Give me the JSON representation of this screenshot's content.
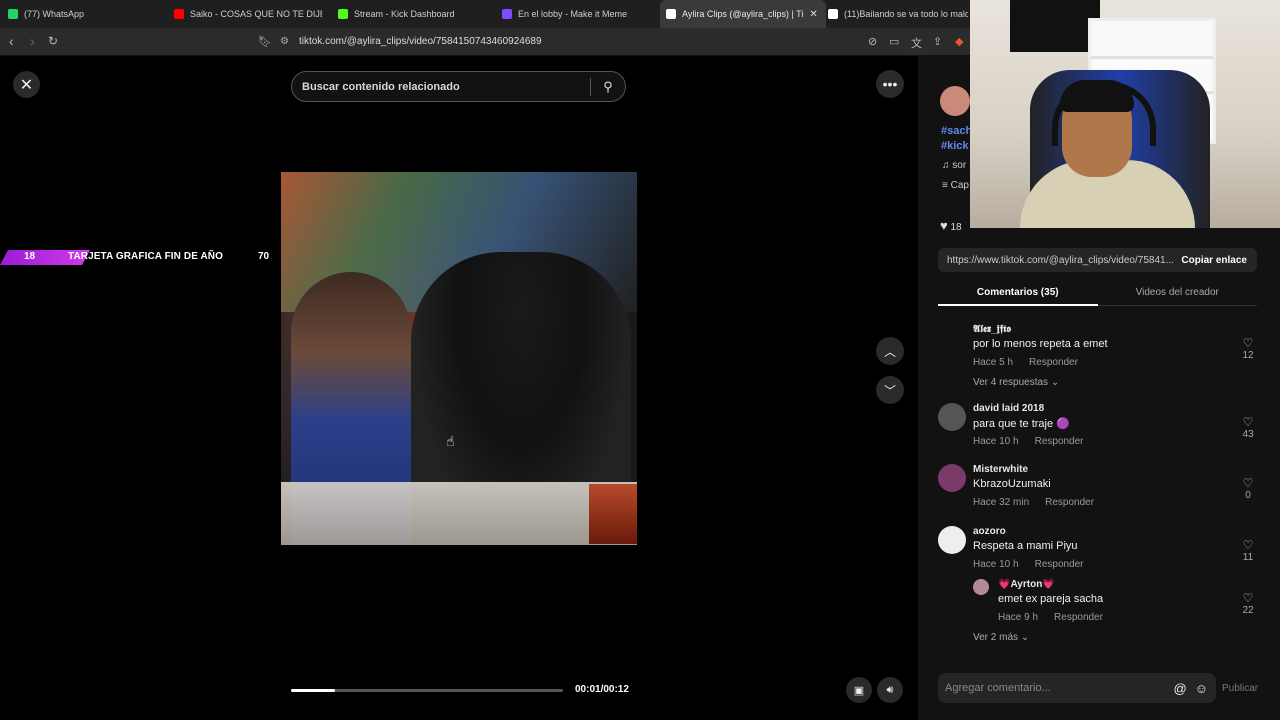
{
  "browser": {
    "tabs": [
      {
        "title": "(77) WhatsApp",
        "color": "#25d366"
      },
      {
        "title": "Saiko - COSAS QUE NO TE DIJE (Offi",
        "color": "#ff0000"
      },
      {
        "title": "Stream - Kick Dashboard",
        "color": "#53fc18"
      },
      {
        "title": "En el lobby - Make it Meme",
        "color": "#7e4bff"
      },
      {
        "title": "Aylira Clips (@aylira_clips) | Ti",
        "color": "#ffffff"
      },
      {
        "title": "(11)Bailando se va todo lo malo",
        "color": "#ffffff"
      }
    ],
    "url": "tiktok.com/@aylira_clips/video/7584150743460924689"
  },
  "overlay_banner": {
    "left_number": "18",
    "label": "TARJETA GRAFICA FIN DE AÑO",
    "right_number": "70"
  },
  "search": {
    "placeholder": "Buscar contenido relacionado"
  },
  "player": {
    "time": "00:01/00:12",
    "progress_fraction": 0.16
  },
  "side": {
    "hashtag1": "#sach",
    "hashtag2": "#kick",
    "music": "sor",
    "caption": "Cap",
    "likes_partial": "18",
    "link": "https://www.tiktok.com/@aylira_clips/video/75841...",
    "copy_label": "Copiar enlace",
    "tab_comments": "Comentarios (35)",
    "tab_videos": "Videos del creador",
    "reply_label": "Responder"
  },
  "comments": [
    {
      "user": "𝕬𝖑𝖊𝖝_𝖏𝖋𝖙𝖔",
      "text": "por lo menos repeta a emet",
      "time": "Hace 5 h",
      "likes": "12",
      "avatar": "#111"
    },
    {
      "user": "david laid 2018",
      "text": "para que te traje 🟣",
      "time": "Hace 10 h",
      "likes": "43",
      "avatar": "#444"
    },
    {
      "user": "Misterwhite",
      "text": "KbrazoUzumaki",
      "time": "Hace 32 min",
      "likes": "0",
      "avatar": "#7a3a6a"
    },
    {
      "user": "aozoro",
      "text": "Respeta a mami Piyu",
      "time": "Hace 10 h",
      "likes": "11",
      "avatar": "#eeeeee"
    }
  ],
  "more_replies_1": "Ver 4 respuestas",
  "reply": {
    "user": "💗Ayrton💗",
    "text": "emet ex pareja sacha",
    "time": "Hace 9 h",
    "likes": "22"
  },
  "more_replies_2": "Ver 2 más",
  "comment_input": {
    "placeholder": "Agregar comentario...",
    "publish": "Publicar"
  }
}
